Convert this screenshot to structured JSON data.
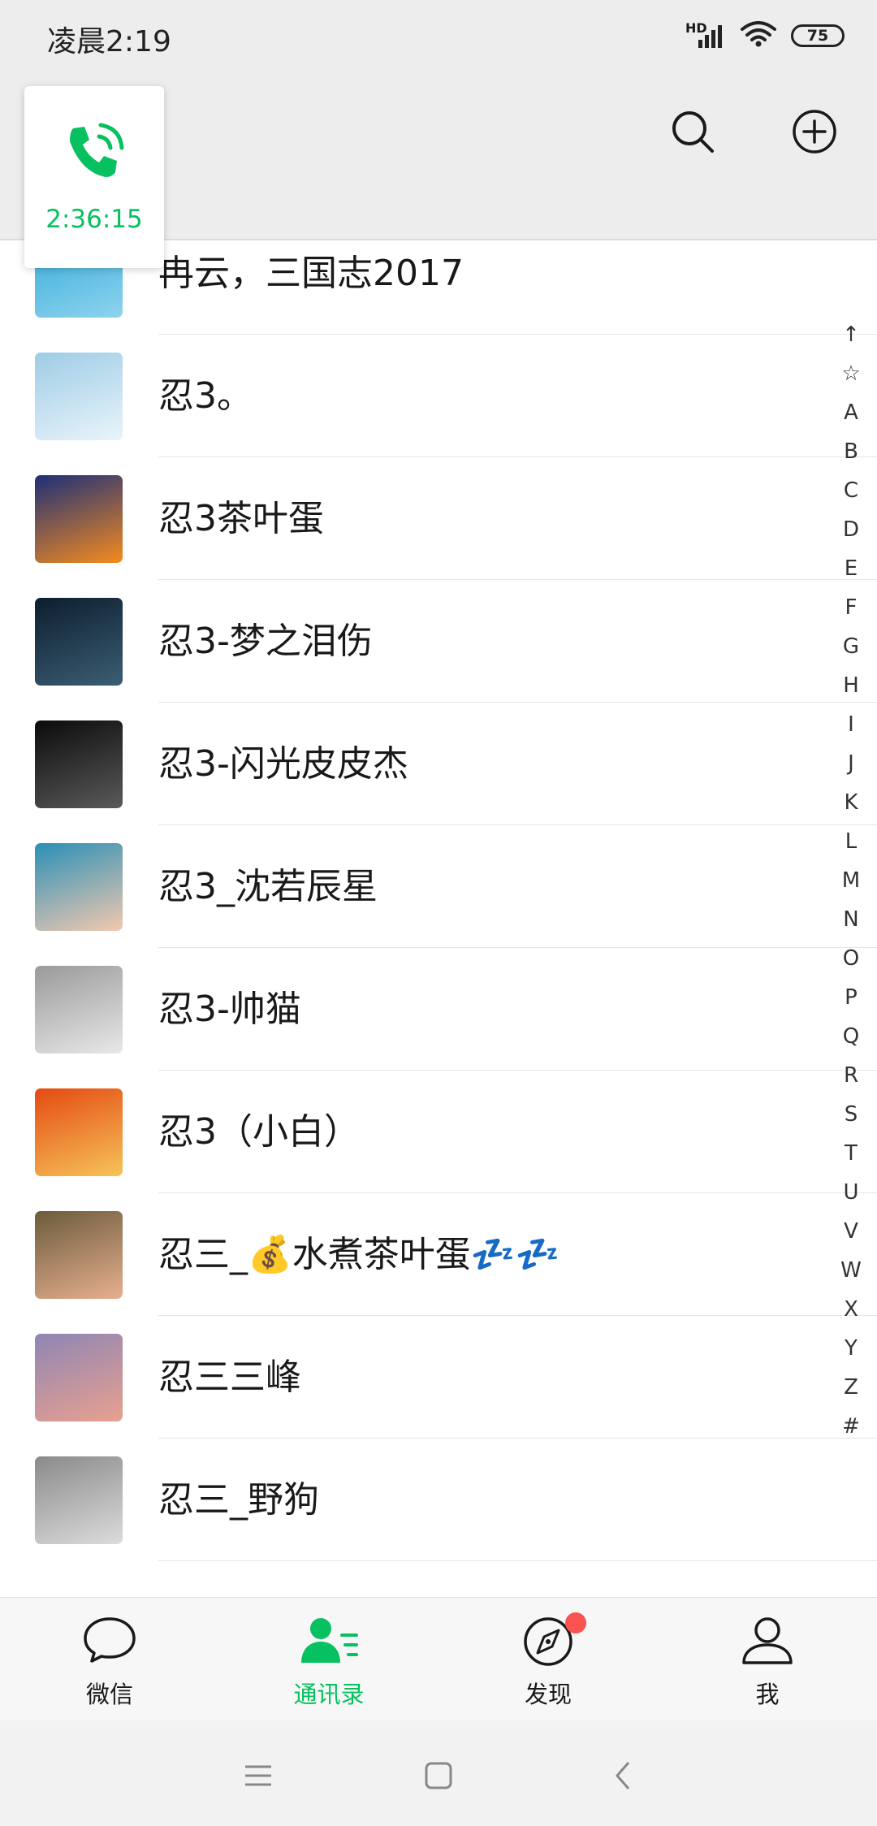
{
  "status_bar": {
    "time": "凌晨2:19",
    "battery": "75",
    "network": "HD"
  },
  "call": {
    "timer": "2:36:15",
    "color": "#07c160"
  },
  "contacts": [
    {
      "name": "冉云，三国志2017",
      "avatar_colors": [
        "#2fa9d8",
        "#8fd3ee"
      ]
    },
    {
      "name": "忍3。",
      "avatar_colors": [
        "#9fcce6",
        "#e9f4fa"
      ]
    },
    {
      "name": "忍3茶叶蛋",
      "avatar_colors": [
        "#1d2f78",
        "#f48b1e"
      ]
    },
    {
      "name": "忍3-梦之泪伤",
      "avatar_colors": [
        "#0d1e2e",
        "#3b5e74"
      ]
    },
    {
      "name": "忍3-闪光皮皮杰",
      "avatar_colors": [
        "#0b0b0b",
        "#5a5a5a"
      ]
    },
    {
      "name": "忍3_沈若辰星",
      "avatar_colors": [
        "#2a8fb6",
        "#f2c9b0"
      ]
    },
    {
      "name": "忍3-帅猫",
      "avatar_colors": [
        "#9a9a9a",
        "#e8e8e8"
      ]
    },
    {
      "name": "忍3（小白）",
      "avatar_colors": [
        "#e44a12",
        "#f6c35a"
      ]
    },
    {
      "name": "忍三_💰水煮茶叶蛋💤💤",
      "avatar_colors": [
        "#6b5b3c",
        "#e7b08f"
      ]
    },
    {
      "name": "忍三三峰",
      "avatar_colors": [
        "#8e86b4",
        "#e9a08f"
      ]
    },
    {
      "name": "忍三_野狗",
      "avatar_colors": [
        "#8a8a8a",
        "#dcdcdc"
      ]
    }
  ],
  "index_letters": [
    "↑",
    "☆",
    "A",
    "B",
    "C",
    "D",
    "E",
    "F",
    "G",
    "H",
    "I",
    "J",
    "K",
    "L",
    "M",
    "N",
    "O",
    "P",
    "Q",
    "R",
    "S",
    "T",
    "U",
    "V",
    "W",
    "X",
    "Y",
    "Z",
    "#"
  ],
  "tabs": [
    {
      "label": "微信",
      "icon": "chat-bubble-icon",
      "active": false
    },
    {
      "label": "通讯录",
      "icon": "contacts-icon",
      "active": true
    },
    {
      "label": "发现",
      "icon": "compass-icon",
      "active": false,
      "badge": true
    },
    {
      "label": "我",
      "icon": "person-icon",
      "active": false
    }
  ],
  "colors": {
    "accent": "#07c160",
    "badge": "#fa5151",
    "header_bg": "#ededed"
  }
}
